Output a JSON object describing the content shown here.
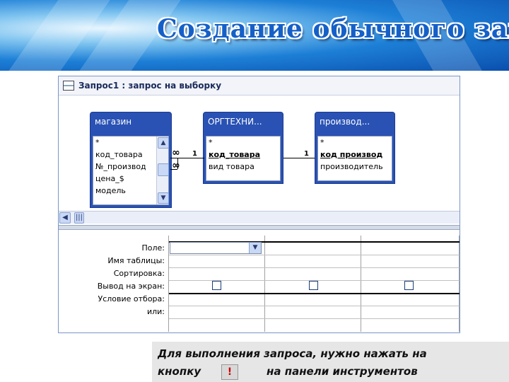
{
  "slide": {
    "title": "Создание обычного запроса",
    "footer": {
      "line1": "Для выполнения запроса, нужно нажать на",
      "line2_a": "кнопку",
      "line2_b": "на панели инструментов",
      "button_glyph": "!"
    }
  },
  "window": {
    "title": "Запрос1 : запрос на выборку"
  },
  "tables": [
    {
      "name": "магазин",
      "fields": [
        "*",
        "код_товара",
        "№_производ",
        "цена_$",
        "модель"
      ],
      "key_fields": []
    },
    {
      "name": "ОРГТЕХНИ...",
      "fields": [
        "*",
        "код_товара",
        "вид товара"
      ],
      "key_fields": [
        "код_товара"
      ]
    },
    {
      "name": "производ...",
      "fields": [
        "*",
        "код производ",
        "производитель"
      ],
      "key_fields": [
        "код производ"
      ]
    }
  ],
  "relations": {
    "label_one": "1",
    "label_many": "∞"
  },
  "grid": {
    "row_labels": [
      "Поле:",
      "Имя таблицы:",
      "Сортировка:",
      "Вывод на экран:",
      "Условие отбора:",
      "или:"
    ]
  },
  "colors": {
    "table_header": "#2a52b4",
    "banner": "#1d7fd6",
    "title": "#1560c8"
  }
}
